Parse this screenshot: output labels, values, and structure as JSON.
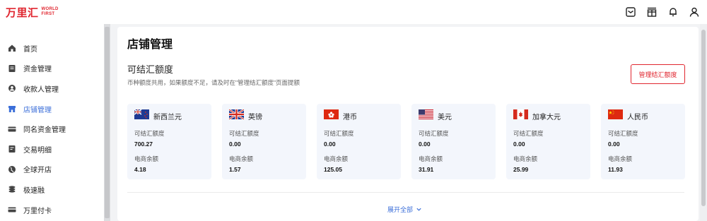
{
  "header": {
    "logo_cn": "万里汇",
    "logo_en_1": "WORLD",
    "logo_en_2": "FIRST",
    "icons": [
      "message-icon",
      "gift-icon",
      "bell-icon",
      "user-icon"
    ]
  },
  "sidebar": {
    "items": [
      {
        "label": "首页",
        "icon": "home-icon"
      },
      {
        "label": "资金管理",
        "icon": "funds-icon"
      },
      {
        "label": "收款人管理",
        "icon": "payee-icon"
      },
      {
        "label": "店铺管理",
        "icon": "store-icon",
        "active": true
      },
      {
        "label": "同名资金管理",
        "icon": "card-icon"
      },
      {
        "label": "交易明细",
        "icon": "transactions-icon"
      },
      {
        "label": "全球开店",
        "icon": "globe-icon"
      },
      {
        "label": "极速融",
        "icon": "finance-icon"
      },
      {
        "label": "万里付卡",
        "icon": "payment-card-icon"
      }
    ],
    "active_color": "#3c6fd9"
  },
  "main": {
    "title": "店铺管理",
    "section_title": "可结汇额度",
    "section_desc": "币种额度共用，如果额度不足，请及时在\"管理结汇额度\"页面提额",
    "manage_button": "管理结汇额度",
    "expand_label": "展开全部",
    "accent_color": "#e0262f",
    "cards": [
      {
        "currency": "新西兰元",
        "flag": "nz",
        "label1": "可结汇额度",
        "value1": "700.27",
        "label2": "电商余额",
        "value2": "4.18"
      },
      {
        "currency": "英镑",
        "flag": "uk",
        "label1": "可结汇额度",
        "value1": "0.00",
        "label2": "电商余额",
        "value2": "1.57"
      },
      {
        "currency": "港币",
        "flag": "hk",
        "label1": "可结汇额度",
        "value1": "0.00",
        "label2": "电商余额",
        "value2": "125.05"
      },
      {
        "currency": "美元",
        "flag": "us",
        "label1": "可结汇额度",
        "value1": "0.00",
        "label2": "电商余额",
        "value2": "31.91"
      },
      {
        "currency": "加拿大元",
        "flag": "ca",
        "label1": "可结汇额度",
        "value1": "0.00",
        "label2": "电商余额",
        "value2": "25.99"
      },
      {
        "currency": "人民币",
        "flag": "cn",
        "label1": "可结汇额度",
        "value1": "0.00",
        "label2": "电商余额",
        "value2": "11.93"
      }
    ]
  }
}
